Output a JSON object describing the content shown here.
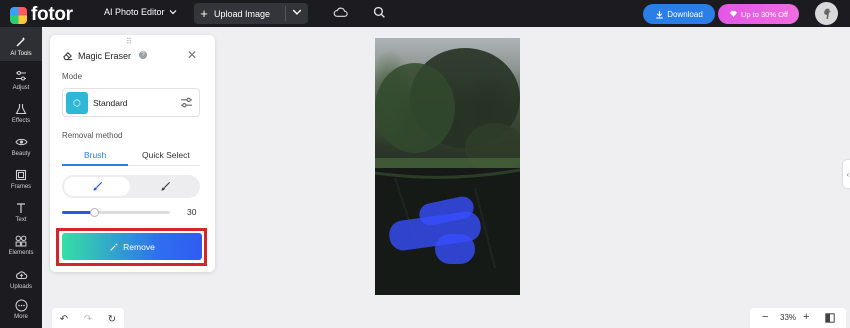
{
  "app": {
    "logo_text": "fotor"
  },
  "header": {
    "editor_menu_label": "AI Photo Editor",
    "upload_label": "Upload Image",
    "download_label": "Download",
    "promo_label": "Up to 30% Off"
  },
  "sidebar": {
    "items": [
      {
        "label": "AI Tools",
        "icon": "magic-wand-icon",
        "active": true
      },
      {
        "label": "Adjust",
        "icon": "sliders-icon"
      },
      {
        "label": "Effects",
        "icon": "flask-icon"
      },
      {
        "label": "Beauty",
        "icon": "eye-icon"
      },
      {
        "label": "Frames",
        "icon": "frame-icon"
      },
      {
        "label": "Text",
        "icon": "text-icon"
      },
      {
        "label": "Elements",
        "icon": "shapes-icon"
      },
      {
        "label": "Uploads",
        "icon": "cloud-upload-icon"
      },
      {
        "label": "More",
        "icon": "more-icon"
      }
    ]
  },
  "panel": {
    "title": "Magic Eraser",
    "mode_label": "Mode",
    "mode_value": "Standard",
    "removal_label": "Removal method",
    "tabs": [
      {
        "label": "Brush",
        "active": true
      },
      {
        "label": "Quick Select",
        "active": false
      }
    ],
    "brush_size": 30,
    "brush_size_fraction": 0.3,
    "remove_label": "Remove"
  },
  "zoom": {
    "value": "33%"
  },
  "colors": {
    "accent": "#2a7ee8",
    "promo": "#e356e8",
    "highlight_border": "#d3262c",
    "mask": "#3750ff"
  }
}
